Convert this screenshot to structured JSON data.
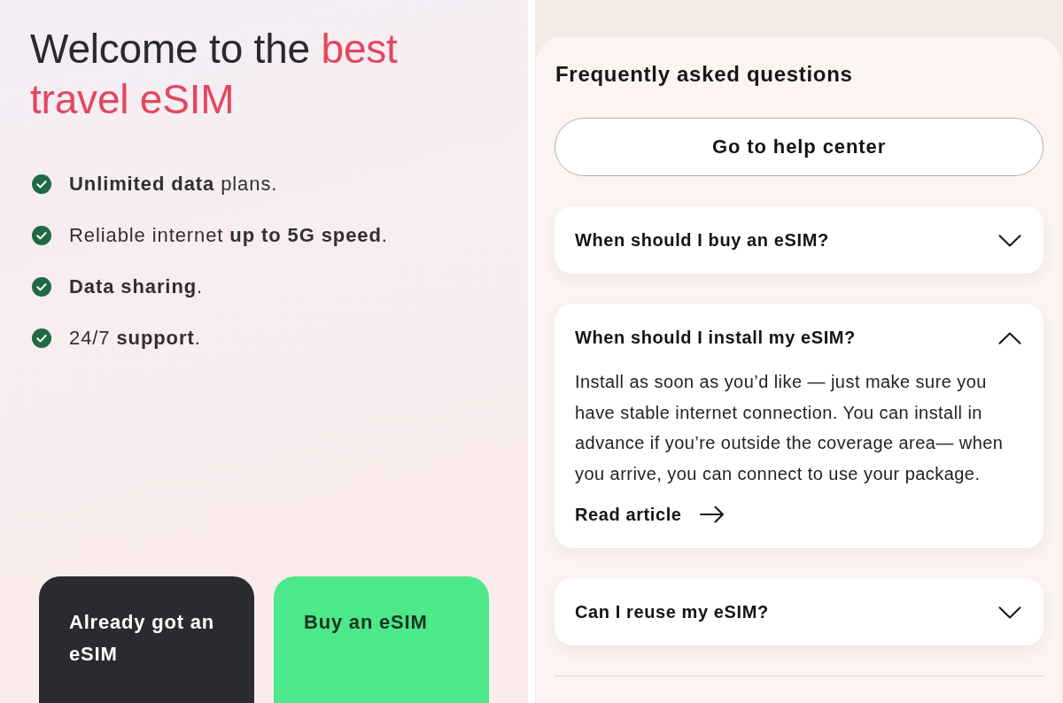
{
  "welcome": {
    "headline": [
      {
        "text": "Welcome to the ",
        "kind": "plain"
      },
      {
        "text": "best travel eSIM",
        "kind": "highlight"
      }
    ],
    "features": [
      "**Unlimited data** plans.",
      "Reliable internet **up to 5G speed**.",
      "**Data sharing**.",
      "24/7 **support**."
    ],
    "buttons": [
      {
        "label": "Already got an eSIM",
        "kind": "dark"
      },
      {
        "label": "Buy an eSIM",
        "kind": "primary"
      }
    ]
  },
  "faq": {
    "title": "Frequently asked questions",
    "help_button": "Go to help center",
    "items": [
      {
        "question": "When should I buy an eSIM?",
        "expanded": false
      },
      {
        "question": "When should I install my eSIM?",
        "expanded": true,
        "answer": "Install as soon as you’d like — just make sure you have stable internet connection. You can install in advance if you’re outside the coverage area— when you arrive, you can connect to use your package.",
        "link": "Read article"
      },
      {
        "question": "Can I reuse my eSIM?",
        "expanded": false
      }
    ]
  }
}
